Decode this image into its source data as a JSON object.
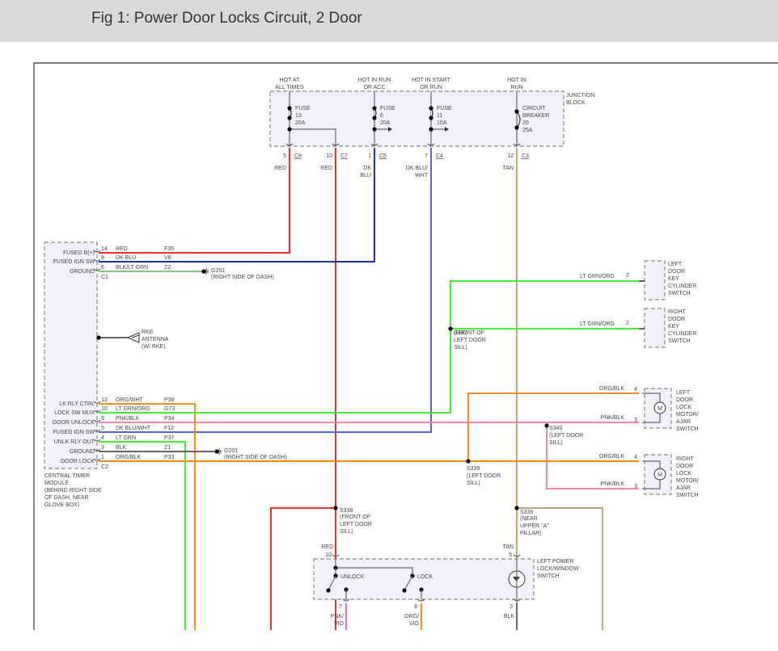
{
  "title": "Fig 1: Power Door Locks Circuit, 2 Door",
  "colors": {
    "red": "#ff2a2a",
    "dkblu": "#1a3399",
    "dkbluwht": "#5566cc",
    "tan": "#c4a678",
    "ltgrn": "#44ee33",
    "orange": "#ff8c1a",
    "pink": "#f08aa0",
    "blk": "#666666",
    "pnkvio": "#ff66bb"
  },
  "junction": {
    "label": [
      "JUNCTION",
      "BLOCK"
    ],
    "sources": [
      [
        "HOT AT",
        "ALL TIMES"
      ],
      [
        "HOT IN RUN",
        "OR ACC"
      ],
      [
        "HOT IN START",
        "OR RUN"
      ],
      [
        "HOT IN",
        "RUN"
      ]
    ],
    "fuses": [
      [
        "FUSE",
        "13",
        "20A"
      ],
      [
        "FUSE",
        "6",
        "20A"
      ],
      [
        "FUSE",
        "11",
        "10A"
      ],
      [
        "CIRCUIT",
        "BREAKER",
        "20",
        "25A"
      ]
    ],
    "pins": [
      {
        "pin": "5",
        "conn": "C8",
        "wire": [
          "RED"
        ]
      },
      {
        "pin": "10",
        "conn": "C7",
        "wire": [
          "RED"
        ]
      },
      {
        "pin": "1",
        "conn": "C5",
        "wire": [
          "DK",
          "BLU"
        ]
      },
      {
        "pin": "7",
        "conn": "C4",
        "wire": [
          "DK BLU/",
          "WHT"
        ]
      },
      {
        "pin": "12",
        "conn": "C3",
        "wire": [
          "TAN"
        ]
      }
    ]
  },
  "module": {
    "label": [
      "CENTRAL TIMER",
      "MODULE",
      "(BEHIND RIGHT SIDE",
      "OF DASH, NEAR",
      "GLOVE BOX)"
    ],
    "c1": "C1",
    "c2": "C2",
    "rows1": [
      {
        "name": "FUSED B(+)",
        "pin": "14",
        "color": "RED",
        "circ": "F35"
      },
      {
        "name": "FUSED IGN SW",
        "pin": "8",
        "color": "DK BLU",
        "circ": "V6"
      },
      {
        "name": "GROUND",
        "pin": "6",
        "color": "BLK/LT GRN",
        "circ": "Z2"
      }
    ],
    "rows2": [
      {
        "name": "LK RLY CTRL",
        "pin": "13",
        "color": "ORG/WHT",
        "circ": "P38"
      },
      {
        "name": "LOCK SW MUX",
        "pin": "10",
        "color": "LT GRN/ORG",
        "circ": "G73"
      },
      {
        "name": "DOOR UNLOCK",
        "pin": "9",
        "color": "PNK/BLK",
        "circ": "P34"
      },
      {
        "name": "FUSED IGN SW",
        "pin": "5",
        "color": "DK BLU/WHT",
        "circ": "F12"
      },
      {
        "name": "UNLK RLY OUT",
        "pin": "4",
        "color": "LT GRN",
        "circ": "P37"
      },
      {
        "name": "GROUND",
        "pin": "3",
        "color": "BLK",
        "circ": "Z1"
      },
      {
        "name": "DOOR LOCK",
        "pin": "1",
        "color": "ORG/BLK",
        "circ": "P33"
      }
    ]
  },
  "grounds": [
    {
      "id": "G201",
      "loc": "(RIGHT SIDE OF DASH)"
    },
    {
      "id": "G201",
      "loc": "(RIGHT SIDE OF DASH)"
    }
  ],
  "rke": [
    "RKE",
    "ANTENNA",
    "(W/ RKE)"
  ],
  "key_switches": [
    {
      "label": [
        "LEFT",
        "DOOR",
        "KEY",
        "CYLINDER",
        "SWITCH"
      ],
      "wire": "LT GRN/ORG",
      "pin": "2"
    },
    {
      "label": [
        "RIGHT",
        "DOOR",
        "KEY",
        "CYLINDER",
        "SWITCH"
      ],
      "wire": "LT GRN/ORG",
      "pin": "2"
    }
  ],
  "motors": [
    {
      "label": [
        "LEFT",
        "DOOR",
        "LOCK",
        "MOTOR/",
        "AJAR",
        "SWITCH"
      ],
      "w4": "ORG/BLK",
      "p4": "4",
      "w3": "PNK/BLK",
      "p3": "3",
      "sym": "M"
    },
    {
      "label": [
        "RIGHT",
        "DOOR",
        "LOCK",
        "MOTOR/",
        "AJAR",
        "SWITCH"
      ],
      "w4": "ORG/BLK",
      "p4": "4",
      "w3": "PNK/BLK",
      "p3": "3",
      "sym": "M"
    }
  ],
  "splices": [
    {
      "id": "S337",
      "loc": [
        "(FRONT OF",
        "LEFT DOOR",
        "SILL)"
      ]
    },
    {
      "id": "S340",
      "loc": [
        "(LEFT DOOR",
        "SILL)"
      ]
    },
    {
      "id": "S339",
      "loc": [
        "(LEFT DOOR",
        "SILL)"
      ]
    },
    {
      "id": "S338",
      "loc": [
        "(FRONT OF",
        "LEFT DOOR",
        "SILL)"
      ]
    },
    {
      "id": "S336",
      "loc": [
        "(NEAR",
        "UPPER \"A\"",
        "PILLAR)"
      ]
    }
  ],
  "lock_switch": {
    "label": [
      "LEFT POWER",
      "LOCK/WINDOW",
      "SWITCH"
    ],
    "unlock": "UNLOCK",
    "lock": "LOCK",
    "top": [
      {
        "wire": "RED",
        "pin": "10"
      },
      {
        "wire": "TAN",
        "pin": "5"
      }
    ],
    "bottom": [
      {
        "pin": "7",
        "wire": [
          "PNK/",
          "VIO"
        ]
      },
      {
        "pin": "8",
        "wire": [
          "ORG/",
          "VIO"
        ]
      },
      {
        "pin": "3",
        "wire": [
          "BLK"
        ]
      }
    ]
  }
}
